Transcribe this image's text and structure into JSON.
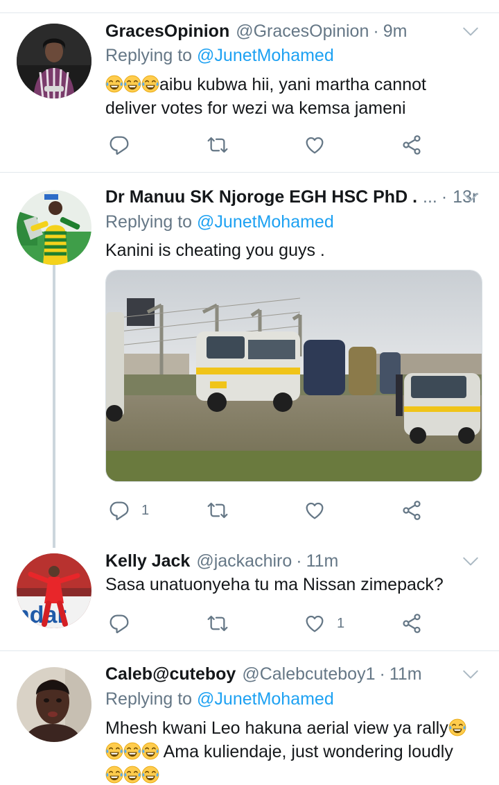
{
  "tweets": [
    {
      "display_name": "GracesOpinion",
      "handle": "@GracesOpinion",
      "time": "9m",
      "replying_prefix": "Replying to",
      "replying_to": "@JunetMohamed",
      "text": "aibu kubwa hii, yani martha cannot deliver votes for wezi wa kemsa jameni",
      "leading_emoji": "face-with-tears-of-joy ×3",
      "reply_count": "",
      "like_count": ""
    },
    {
      "display_name": "Dr Manuu SK Njoroge EGH HSC PhD .",
      "name_overflow": "...",
      "time": "13m",
      "replying_prefix": "Replying to",
      "replying_to": "@JunetMohamed",
      "text": "Kanini is cheating you guys .",
      "media": "photo of matatu minibuses parked by a fence",
      "reply_count": "1",
      "like_count": ""
    },
    {
      "display_name": "Kelly Jack",
      "handle": "@jackachiro",
      "time": "11m",
      "text": "Sasa unatuonyeha tu ma Nissan zimepack?",
      "reply_count": "",
      "like_count": "1"
    },
    {
      "display_name": "Caleb@cuteboy",
      "handle": "@Calebcuteboy1",
      "time": "11m",
      "replying_prefix": "Replying to",
      "replying_to": "@JunetMohamed",
      "text_line1": "Mhesh kwani Leo hakuna aerial view ya rally",
      "text_line2": " Ama kuliendaje, just wondering loudly",
      "emoji": "face-with-tears-of-joy"
    }
  ],
  "separator": "·",
  "colors": {
    "text": "#14171a",
    "secondary": "#657786",
    "link": "#1da1f2",
    "divider": "#e1e8ed",
    "thread_line": "#ccd6dd"
  },
  "icons": [
    "reply-icon",
    "retweet-icon",
    "like-icon",
    "share-icon",
    "chevron-down-icon"
  ]
}
